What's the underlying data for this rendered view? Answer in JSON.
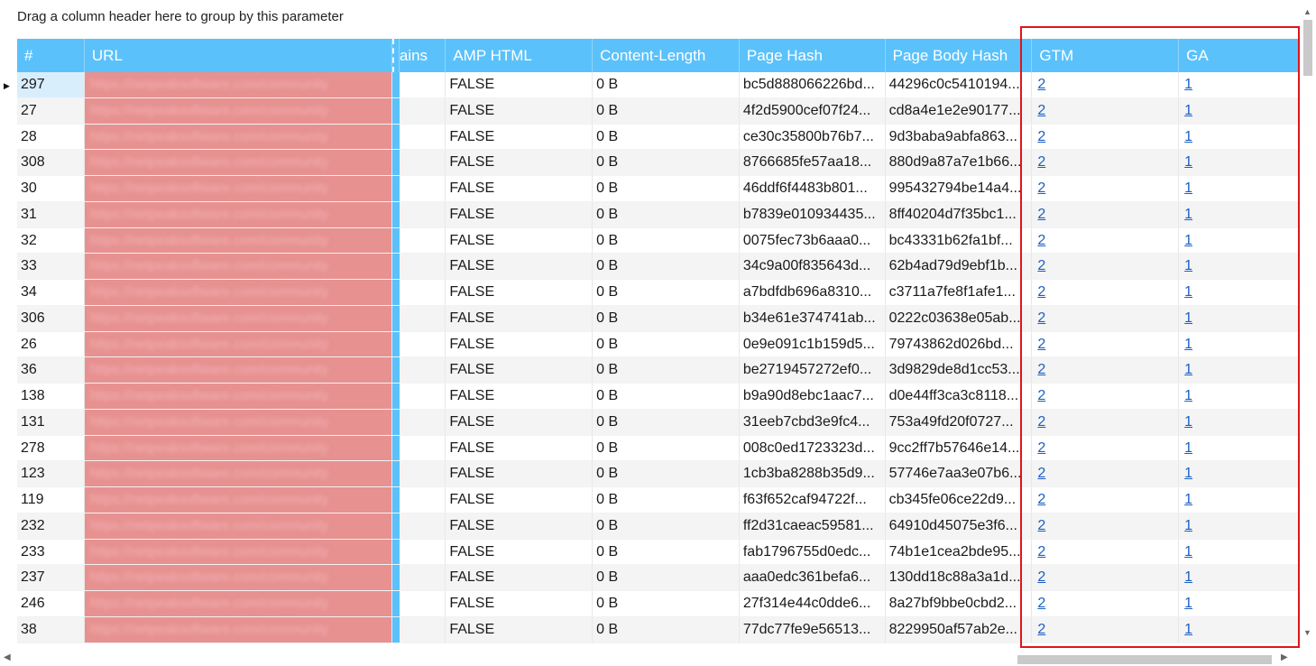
{
  "group_hint": "Drag a column header here to group by this parameter",
  "columns": {
    "num": "#",
    "url": "URL",
    "chains": "hains",
    "amp": "AMP HTML",
    "length": "Content-Length",
    "page_hash": "Page Hash",
    "body_hash": "Page Body Hash",
    "gtm": "GTM",
    "ga": "GA"
  },
  "rows": [
    {
      "num": "297",
      "url": "https://netpeaksoftware.com/community",
      "amp": "FALSE",
      "length": "0 B",
      "page_hash": "bc5d888066226bd...",
      "body_hash": "44296c0c5410194...",
      "gtm": "2",
      "ga": "1"
    },
    {
      "num": "27",
      "url": "https://netpeaksoftware.com/community",
      "amp": "FALSE",
      "length": "0 B",
      "page_hash": "4f2d5900cef07f24...",
      "body_hash": "cd8a4e1e2e90177...",
      "gtm": "2",
      "ga": "1"
    },
    {
      "num": "28",
      "url": "https://netpeaksoftware.com/community",
      "amp": "FALSE",
      "length": "0 B",
      "page_hash": "ce30c35800b76b7...",
      "body_hash": "9d3baba9abfa863...",
      "gtm": "2",
      "ga": "1"
    },
    {
      "num": "308",
      "url": "https://netpeaksoftware.com/community",
      "amp": "FALSE",
      "length": "0 B",
      "page_hash": "8766685fe57aa18...",
      "body_hash": "880d9a87a7e1b66...",
      "gtm": "2",
      "ga": "1"
    },
    {
      "num": "30",
      "url": "https://netpeaksoftware.com/community",
      "amp": "FALSE",
      "length": "0 B",
      "page_hash": "46ddf6f4483b801...",
      "body_hash": "995432794be14a4...",
      "gtm": "2",
      "ga": "1"
    },
    {
      "num": "31",
      "url": "https://netpeaksoftware.com/community",
      "amp": "FALSE",
      "length": "0 B",
      "page_hash": "b7839e010934435...",
      "body_hash": "8ff40204d7f35bc1...",
      "gtm": "2",
      "ga": "1"
    },
    {
      "num": "32",
      "url": "https://netpeaksoftware.com/community",
      "amp": "FALSE",
      "length": "0 B",
      "page_hash": "0075fec73b6aaa0...",
      "body_hash": "bc43331b62fa1bf...",
      "gtm": "2",
      "ga": "1"
    },
    {
      "num": "33",
      "url": "https://netpeaksoftware.com/community",
      "amp": "FALSE",
      "length": "0 B",
      "page_hash": "34c9a00f835643d...",
      "body_hash": "62b4ad79d9ebf1b...",
      "gtm": "2",
      "ga": "1"
    },
    {
      "num": "34",
      "url": "https://netpeaksoftware.com/community",
      "amp": "FALSE",
      "length": "0 B",
      "page_hash": "a7bdfdb696a8310...",
      "body_hash": "c3711a7fe8f1afe1...",
      "gtm": "2",
      "ga": "1"
    },
    {
      "num": "306",
      "url": "https://netpeaksoftware.com/community",
      "amp": "FALSE",
      "length": "0 B",
      "page_hash": "b34e61e374741ab...",
      "body_hash": "0222c03638e05ab...",
      "gtm": "2",
      "ga": "1"
    },
    {
      "num": "26",
      "url": "https://netpeaksoftware.com/community",
      "amp": "FALSE",
      "length": "0 B",
      "page_hash": "0e9e091c1b159d5...",
      "body_hash": "79743862d026bd...",
      "gtm": "2",
      "ga": "1"
    },
    {
      "num": "36",
      "url": "https://netpeaksoftware.com/community",
      "amp": "FALSE",
      "length": "0 B",
      "page_hash": "be2719457272ef0...",
      "body_hash": "3d9829de8d1cc53...",
      "gtm": "2",
      "ga": "1"
    },
    {
      "num": "138",
      "url": "https://netpeaksoftware.com/community",
      "amp": "FALSE",
      "length": "0 B",
      "page_hash": "b9a90d8ebc1aac7...",
      "body_hash": "d0e44ff3ca3c8118...",
      "gtm": "2",
      "ga": "1"
    },
    {
      "num": "131",
      "url": "https://netpeaksoftware.com/community",
      "amp": "FALSE",
      "length": "0 B",
      "page_hash": "31eeb7cbd3e9fc4...",
      "body_hash": "753a49fd20f0727...",
      "gtm": "2",
      "ga": "1"
    },
    {
      "num": "278",
      "url": "https://netpeaksoftware.com/community",
      "amp": "FALSE",
      "length": "0 B",
      "page_hash": "008c0ed1723323d...",
      "body_hash": "9cc2ff7b57646e14...",
      "gtm": "2",
      "ga": "1"
    },
    {
      "num": "123",
      "url": "https://netpeaksoftware.com/community",
      "amp": "FALSE",
      "length": "0 B",
      "page_hash": "1cb3ba8288b35d9...",
      "body_hash": "57746e7aa3e07b6...",
      "gtm": "2",
      "ga": "1"
    },
    {
      "num": "119",
      "url": "https://netpeaksoftware.com/community",
      "amp": "FALSE",
      "length": "0 B",
      "page_hash": "f63f652caf94722f...",
      "body_hash": "cb345fe06ce22d9...",
      "gtm": "2",
      "ga": "1"
    },
    {
      "num": "232",
      "url": "https://netpeaksoftware.com/community",
      "amp": "FALSE",
      "length": "0 B",
      "page_hash": "ff2d31caeac59581...",
      "body_hash": "64910d45075e3f6...",
      "gtm": "2",
      "ga": "1"
    },
    {
      "num": "233",
      "url": "https://netpeaksoftware.com/community",
      "amp": "FALSE",
      "length": "0 B",
      "page_hash": "fab1796755d0edc...",
      "body_hash": "74b1e1cea2bde95...",
      "gtm": "2",
      "ga": "1"
    },
    {
      "num": "237",
      "url": "https://netpeaksoftware.com/community",
      "amp": "FALSE",
      "length": "0 B",
      "page_hash": "aaa0edc361befa6...",
      "body_hash": "130dd18c88a3a1d...",
      "gtm": "2",
      "ga": "1"
    },
    {
      "num": "246",
      "url": "https://netpeaksoftware.com/community",
      "amp": "FALSE",
      "length": "0 B",
      "page_hash": "27f314e44c0dde6...",
      "body_hash": "8a27bf9bbe0cbd2...",
      "gtm": "2",
      "ga": "1"
    },
    {
      "num": "38",
      "url": "https://netpeaksoftware.com/community",
      "amp": "FALSE",
      "length": "0 B",
      "page_hash": "77dc77fe9e56513...",
      "body_hash": "8229950af57ab2e...",
      "gtm": "2",
      "ga": "1"
    }
  ],
  "colors": {
    "header_bg": "#5bc1fb",
    "url_redaction": "#e79191",
    "highlight_border": "#e0141b",
    "link": "#1a5fc4"
  },
  "icons": {
    "row_indicator": "triangle-right-icon",
    "scroll_up": "arrow-up-icon",
    "scroll_down": "arrow-down-icon",
    "scroll_left": "arrow-left-icon",
    "scroll_right": "arrow-right-icon"
  }
}
